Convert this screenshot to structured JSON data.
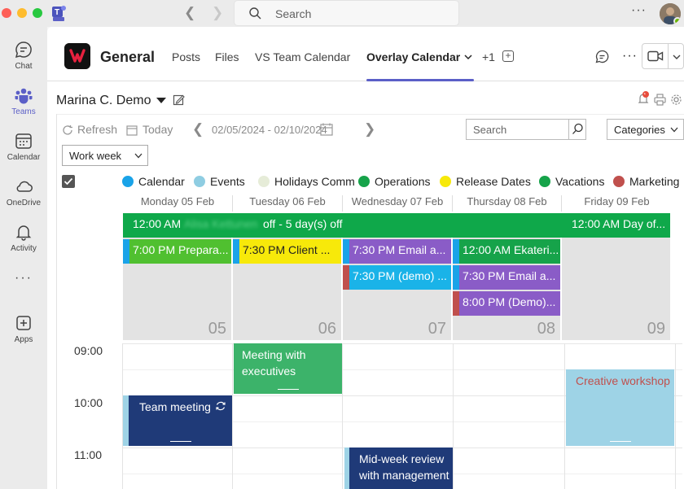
{
  "app": {
    "search_placeholder": "Search"
  },
  "rail": [
    {
      "label": "Chat",
      "icon": "chat-icon"
    },
    {
      "label": "Teams",
      "icon": "teams-icon",
      "active": true
    },
    {
      "label": "Calendar",
      "icon": "calendar-icon"
    },
    {
      "label": "OneDrive",
      "icon": "cloud-icon"
    },
    {
      "label": "Activity",
      "icon": "bell-icon"
    },
    {
      "label": "Apps",
      "icon": "apps-icon"
    }
  ],
  "channel": {
    "name": "General",
    "tabs": [
      "Posts",
      "Files",
      "VS Team Calendar",
      "Overlay Calendar",
      "+1"
    ],
    "active_tab": "Overlay Calendar"
  },
  "calendar": {
    "owner": "Marina C. Demo",
    "refresh": "Refresh",
    "today": "Today",
    "date_range": "02/05/2024 - 02/10/2024",
    "search_placeholder": "Search",
    "categories": "Categories",
    "view": "Work week",
    "legend": [
      {
        "name": "Calendar",
        "color": "#1aa3e8"
      },
      {
        "name": "Events",
        "color": "#8fcde2"
      },
      {
        "name": "Holidays Comm",
        "color": "#e6ecd8"
      },
      {
        "name": "Operations",
        "color": "#16a34a"
      },
      {
        "name": "Release Dates",
        "color": "#f7e90a"
      },
      {
        "name": "Vacations",
        "color": "#16a34a"
      },
      {
        "name": "Marketing",
        "color": "#c0504d"
      }
    ],
    "days": [
      {
        "header": "Monday 05 Feb",
        "num": "05"
      },
      {
        "header": "Tuesday 06 Feb",
        "num": "06"
      },
      {
        "header": "Wednesday 07 Feb",
        "num": "07"
      },
      {
        "header": "Thursday 08 Feb",
        "num": "08"
      },
      {
        "header": "Friday 09 Feb",
        "num": "09"
      }
    ],
    "allday": {
      "left_time": "12:00 AM",
      "left_name": "Alisa Kettunen",
      "left_rest": "off - 5 day(s) off",
      "right": "12:00 AM Day of..."
    },
    "day_events": [
      {
        "text": "7:00 PM Prepara...",
        "bg": "#50c030",
        "accent": "#1aa3e8"
      },
      {
        "text": "7:30 PM Client ...",
        "bg": "#f7e90a",
        "accent": "#1aa3e8",
        "dark": true
      },
      {
        "text": "7:30 PM Email a...",
        "bg": "#8a5cc7",
        "accent": "#1aa3e8"
      },
      {
        "text": "7:30 PM (demo) ...",
        "bg": "#1ab3e8",
        "accent": "#c0504d"
      },
      {
        "text": "12:00 AM Ekateri...",
        "bg": "#16a34a",
        "accent": "#1aa3e8"
      },
      {
        "text": "7:30 PM Email a...",
        "bg": "#8a5cc7",
        "accent": "#1aa3e8"
      },
      {
        "text": "8:00 PM (Demo)...",
        "bg": "#8a5cc7",
        "accent": "#c0504d"
      }
    ],
    "times": [
      "09:00",
      "10:00",
      "11:00"
    ],
    "timed_events": [
      {
        "title": "Meeting with executives",
        "bg": "#3cb36a"
      },
      {
        "title": "Creative workshop",
        "bg": "#9ed3e6",
        "color": "#c0504d"
      },
      {
        "title": "Team meeting",
        "bg": "#1f3a78",
        "recurring": true
      },
      {
        "title": "Mid-week review with management",
        "bg": "#1f3a78"
      }
    ]
  }
}
